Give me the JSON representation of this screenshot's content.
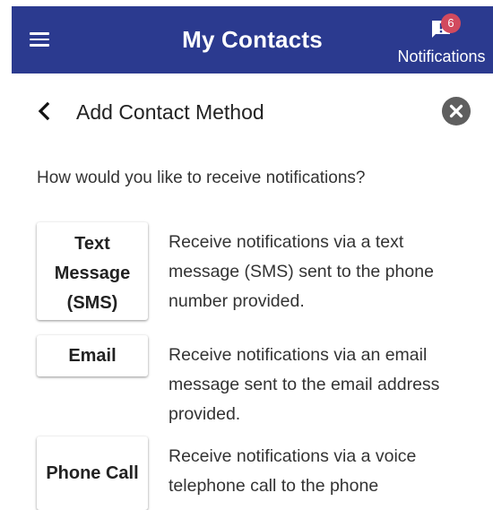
{
  "app_bar": {
    "title": "My Contacts",
    "notifications_label": "Notifications",
    "notification_count": "6",
    "background": "#2b3a8f",
    "badge_color": "#d24a5e"
  },
  "section": {
    "title": "Add Contact Method"
  },
  "prompt": "How would you like to receive notifications?",
  "options": [
    {
      "label": "Text Message (SMS)",
      "description": "Receive notifications via a text message (SMS) sent to the phone number provided."
    },
    {
      "label": "Email",
      "description": "Receive notifications via an email message sent to the email address provided."
    },
    {
      "label": "Phone Call",
      "description": "Receive notifications via a voice telephone call to the phone"
    }
  ],
  "icons": {
    "menu": "hamburger-menu-icon",
    "notifications": "chat-alert-icon",
    "back": "chevron-left-icon",
    "close": "close-circle-icon"
  }
}
